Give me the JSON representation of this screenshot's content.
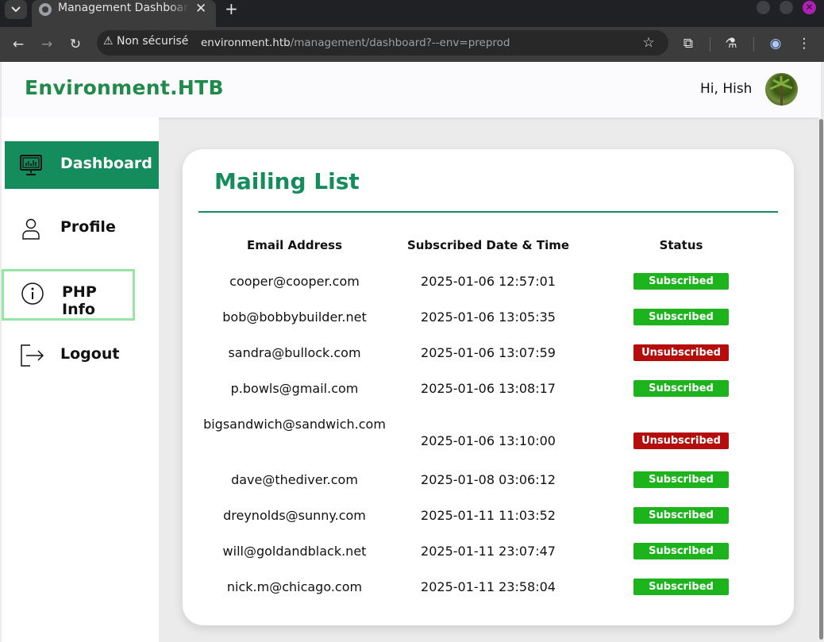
{
  "browser": {
    "tab_title": "Management Dashboard",
    "tab_close": "✕",
    "new_tab": "+",
    "security_label": "Non sécurisé",
    "url_host": "environment.htb",
    "url_path": "/management/dashboard?--env=preprod"
  },
  "header": {
    "brand": "Environment.HTB",
    "greeting": "Hi, Hish"
  },
  "sidebar": {
    "items": [
      {
        "label": "Dashboard",
        "icon": "dashboard-monitor-icon"
      },
      {
        "label": "Profile",
        "icon": "user-icon"
      },
      {
        "label": "PHP Info",
        "icon": "info-icon"
      },
      {
        "label": "Logout",
        "icon": "logout-icon"
      }
    ]
  },
  "main": {
    "title": "Mailing List",
    "columns": [
      "Email Address",
      "Subscribed Date & Time",
      "Status"
    ],
    "rows": [
      {
        "email": "cooper@cooper.com",
        "date": "2025-01-06 12:57:01",
        "status": "Subscribed"
      },
      {
        "email": "bob@bobbybuilder.net",
        "date": "2025-01-06 13:05:35",
        "status": "Subscribed"
      },
      {
        "email": "sandra@bullock.com",
        "date": "2025-01-06 13:07:59",
        "status": "Unsubscribed"
      },
      {
        "email": "p.bowls@gmail.com",
        "date": "2025-01-06 13:08:17",
        "status": "Subscribed"
      },
      {
        "email": "bigsandwich@sandwich.com",
        "date": "2025-01-06 13:10:00",
        "status": "Unsubscribed"
      },
      {
        "email": "dave@thediver.com",
        "date": "2025-01-08 03:06:12",
        "status": "Subscribed"
      },
      {
        "email": "dreynolds@sunny.com",
        "date": "2025-01-11 11:03:52",
        "status": "Subscribed"
      },
      {
        "email": "will@goldandblack.net",
        "date": "2025-01-11 23:07:47",
        "status": "Subscribed"
      },
      {
        "email": "nick.m@chicago.com",
        "date": "2025-01-11 23:58:04",
        "status": "Subscribed"
      }
    ]
  },
  "colors": {
    "brand_green": "#1f8a4a",
    "accent": "#158c5b",
    "subscribed": "#1db31d",
    "unsubscribed": "#b50c0c"
  }
}
